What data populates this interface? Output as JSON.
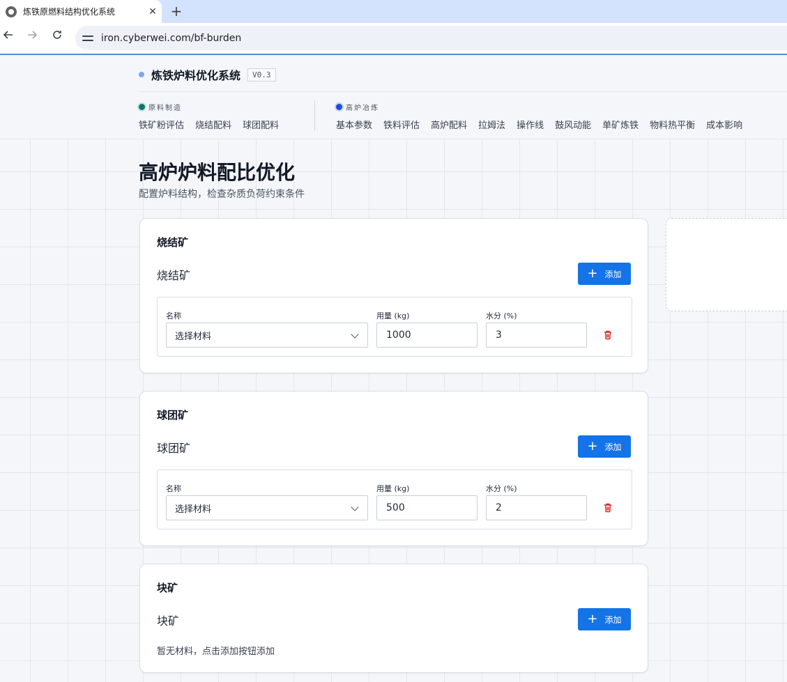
{
  "browser": {
    "tab_title": "炼铁原燃料结构优化系统",
    "tab_close": "✕",
    "new_tab": "+",
    "url": "iron.cyberwei.com/bf-burden"
  },
  "header": {
    "brand": "炼铁炉料优化系统",
    "version": "V0.3",
    "groups": [
      {
        "label": "原料制造",
        "dot_color": "#0f766e",
        "items": [
          "铁矿粉评估",
          "烧结配料",
          "球团配料"
        ]
      },
      {
        "label": "高炉冶炼",
        "dot_color": "#1d4ed8",
        "items": [
          "基本参数",
          "铁料评估",
          "高炉配料",
          "拉姆法",
          "操作线",
          "鼓风动能",
          "单矿炼铁",
          "物料热平衡",
          "成本影响"
        ]
      }
    ]
  },
  "page": {
    "title": "高炉炉料配比优化",
    "subtitle": "配置炉料结构，检查杂质负荷约束条件"
  },
  "fields": {
    "name_label": "名称",
    "amount_label": "用量 (kg)",
    "moisture_label": "水分 (%)",
    "select_placeholder": "选择材料"
  },
  "add_label": "添加",
  "sections": [
    {
      "heading": "烧结矿",
      "subheading": "烧结矿",
      "amount": "1000",
      "moisture": "3"
    },
    {
      "heading": "球团矿",
      "subheading": "球团矿",
      "amount": "500",
      "moisture": "2"
    },
    {
      "heading": "块矿",
      "subheading": "块矿",
      "empty_text": "暂无材料，点击添加按钮添加"
    }
  ],
  "colors": {
    "primary": "#1473e6",
    "danger": "#dc2626"
  }
}
